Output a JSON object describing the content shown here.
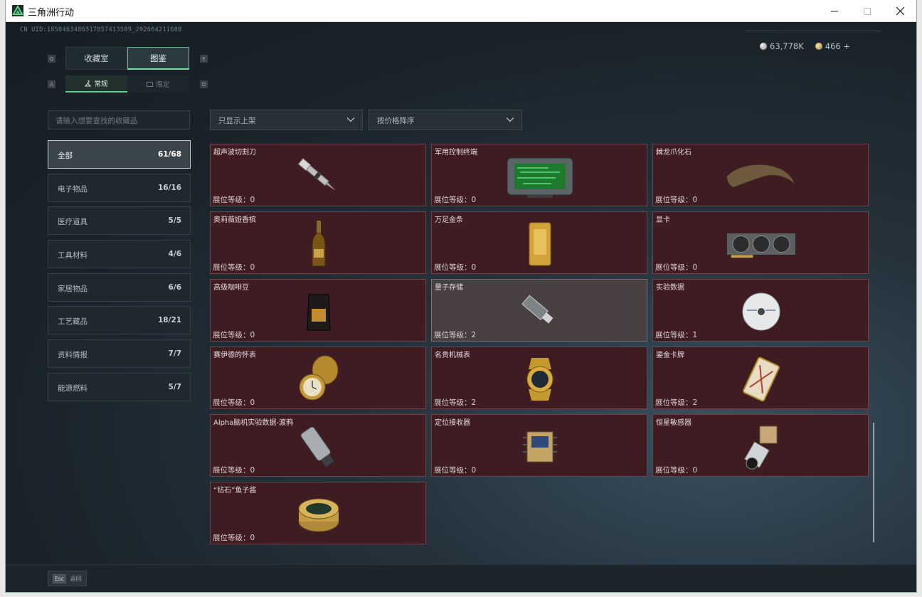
{
  "window": {
    "title": "三角洲行动"
  },
  "header": {
    "uid": "CN UID:1850463486517857413589_202604211608"
  },
  "currency": {
    "silver": "63,778K",
    "gold": "466 +"
  },
  "tabs": [
    {
      "label": "收藏室",
      "key": "Q"
    },
    {
      "label": "图鉴",
      "key": "E"
    }
  ],
  "subtabs": [
    {
      "label": "常规",
      "key": "A"
    },
    {
      "label": "限定",
      "key": "D"
    }
  ],
  "search": {
    "placeholder": "请输入想要查找的收藏品"
  },
  "filters": {
    "shelf": "只显示上架",
    "sort": "按价格降序"
  },
  "categories": [
    {
      "label": "全部",
      "count": "61/68"
    },
    {
      "label": "电子物品",
      "count": "16/16"
    },
    {
      "label": "医疗道具",
      "count": "5/5"
    },
    {
      "label": "工具材料",
      "count": "4/6"
    },
    {
      "label": "家居物品",
      "count": "6/6"
    },
    {
      "label": "工艺藏品",
      "count": "18/21"
    },
    {
      "label": "资料情报",
      "count": "7/7"
    },
    {
      "label": "能源燃料",
      "count": "5/7"
    }
  ],
  "items": [
    {
      "name": "超声波切割刀",
      "level": "展位等级：0",
      "icon": "ultrasonic-knife-icon"
    },
    {
      "name": "军用控制终端",
      "level": "展位等级：0",
      "icon": "military-terminal-icon"
    },
    {
      "name": "棘龙爪化石",
      "level": "展位等级：0",
      "icon": "claw-fossil-icon"
    },
    {
      "name": "奥莉薇娅香槟",
      "level": "展位等级：0",
      "icon": "champagne-icon"
    },
    {
      "name": "万足金条",
      "level": "展位等级：0",
      "icon": "gold-bar-icon"
    },
    {
      "name": "显卡",
      "level": "展位等级：0",
      "icon": "graphics-card-icon"
    },
    {
      "name": "高级咖啡豆",
      "level": "展位等级：0",
      "icon": "coffee-bag-icon"
    },
    {
      "name": "量子存储",
      "level": "展位等级：2",
      "icon": "usb-drive-icon"
    },
    {
      "name": "实验数据",
      "level": "展位等级：1",
      "icon": "disc-icon"
    },
    {
      "name": "赛伊德的怀表",
      "level": "展位等级：0",
      "icon": "pocket-watch-icon"
    },
    {
      "name": "名贵机械表",
      "level": "展位等级：2",
      "icon": "wristwatch-icon"
    },
    {
      "name": "鎏金卡牌",
      "level": "展位等级：2",
      "icon": "gilded-card-icon"
    },
    {
      "name": "Alpha脑机实验数据-渡鸦",
      "level": "展位等级：0",
      "icon": "data-cylinder-icon"
    },
    {
      "name": "定位接收器",
      "level": "展位等级：0",
      "icon": "receiver-icon"
    },
    {
      "name": "恒星敏感器",
      "level": "展位等级：0",
      "icon": "star-sensor-icon"
    },
    {
      "name": "“钻石”鱼子酱",
      "level": "展位等级：0",
      "icon": "caviar-tin-icon"
    }
  ],
  "footer": {
    "esc_key": "Esc",
    "esc_label": "返回"
  },
  "colors": {
    "accent": "#6fe0a4",
    "card_bg": "#3e1c22",
    "card_highlight": "#473f40"
  }
}
